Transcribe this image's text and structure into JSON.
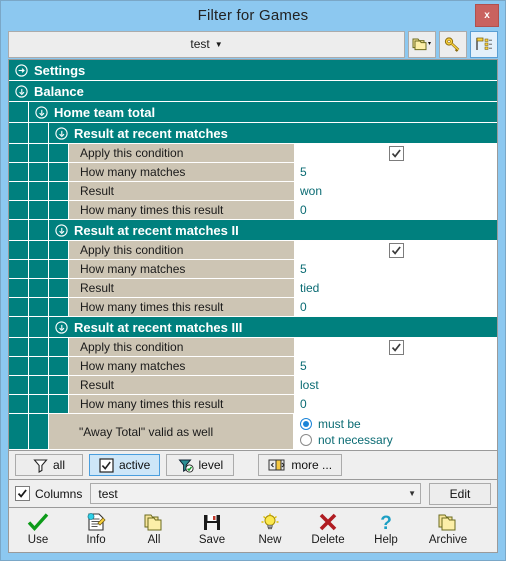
{
  "window": {
    "title": "Filter for Games",
    "close_label": "x"
  },
  "toolbar": {
    "preset_value": "test",
    "preset_caret": "▼",
    "buttons": [
      {
        "name": "folder-dropdown-button",
        "icon": "folder-stack-icon"
      },
      {
        "name": "key-button",
        "icon": "key-icon"
      },
      {
        "name": "filter-list-button",
        "icon": "filter-list-icon"
      }
    ]
  },
  "tree": {
    "groups": [
      {
        "label": "Settings",
        "level": 0,
        "expanded": false,
        "icon": "circle-arrow-right-icon"
      },
      {
        "label": "Balance",
        "level": 0,
        "expanded": true,
        "icon": "circle-arrow-down-icon"
      },
      {
        "label": "Home team total",
        "level": 1,
        "expanded": true,
        "icon": "circle-arrow-down-icon"
      },
      {
        "label": "Result at recent matches",
        "level": 2,
        "expanded": true,
        "icon": "circle-arrow-down-icon"
      },
      {
        "label": "Result at recent matches II",
        "level": 2,
        "expanded": true,
        "icon": "circle-arrow-down-icon"
      },
      {
        "label": "Result at recent matches III",
        "level": 2,
        "expanded": true,
        "icon": "circle-arrow-down-icon"
      }
    ],
    "section1": [
      {
        "label": "Apply this condition",
        "type": "checkbox",
        "checked": true
      },
      {
        "label": "How many matches",
        "type": "text",
        "value": "5"
      },
      {
        "label": "Result",
        "type": "text",
        "value": "won"
      },
      {
        "label": "How many times this result",
        "type": "text",
        "value": "0"
      }
    ],
    "section2": [
      {
        "label": "Apply this condition",
        "type": "checkbox",
        "checked": true
      },
      {
        "label": "How many matches",
        "type": "text",
        "value": "5"
      },
      {
        "label": "Result",
        "type": "text",
        "value": "tied"
      },
      {
        "label": "How many times this result",
        "type": "text",
        "value": "0"
      }
    ],
    "section3": [
      {
        "label": "Apply this condition",
        "type": "checkbox",
        "checked": true
      },
      {
        "label": "How many matches",
        "type": "text",
        "value": "5"
      },
      {
        "label": "Result",
        "type": "text",
        "value": "lost"
      },
      {
        "label": "How many times this result",
        "type": "text",
        "value": "0"
      }
    ],
    "away_total": {
      "label": "\"Away Total\" valid as well",
      "options": [
        "must be",
        "not necessary"
      ],
      "selected": "must be"
    }
  },
  "filter_strip": {
    "buttons": [
      {
        "label": "all",
        "icon": "funnel-icon",
        "selected": false
      },
      {
        "label": "active",
        "icon": "checkbox-icon",
        "selected": true
      },
      {
        "label": "level",
        "icon": "funnel-check-icon",
        "selected": false
      },
      {
        "label": "more ...",
        "icon": "panel-icon",
        "selected": false
      }
    ]
  },
  "columns_strip": {
    "checkbox_label": "Columns",
    "checkbox_checked": true,
    "combo_value": "test",
    "edit_label": "Edit"
  },
  "icon_bar": {
    "items": [
      {
        "label": "Use",
        "icon": "check-icon"
      },
      {
        "label": "Info",
        "icon": "info-document-icon"
      },
      {
        "label": "All",
        "icon": "folder-stack-icon"
      },
      {
        "label": "Save",
        "icon": "floppy-disk-icon"
      },
      {
        "label": "New",
        "icon": "lightbulb-icon"
      },
      {
        "label": "Delete",
        "icon": "red-x-icon"
      },
      {
        "label": "Help",
        "icon": "question-mark-icon"
      },
      {
        "label": "Archive",
        "icon": "folder-stack-icon"
      }
    ]
  },
  "colors": {
    "titlebar": "#8CC8F0",
    "group_header": "#00807E",
    "label_column": "#CDC5B4",
    "value_text": "#0a6b73",
    "close_button": "#C9625F",
    "selection": "#CDE6F8"
  }
}
